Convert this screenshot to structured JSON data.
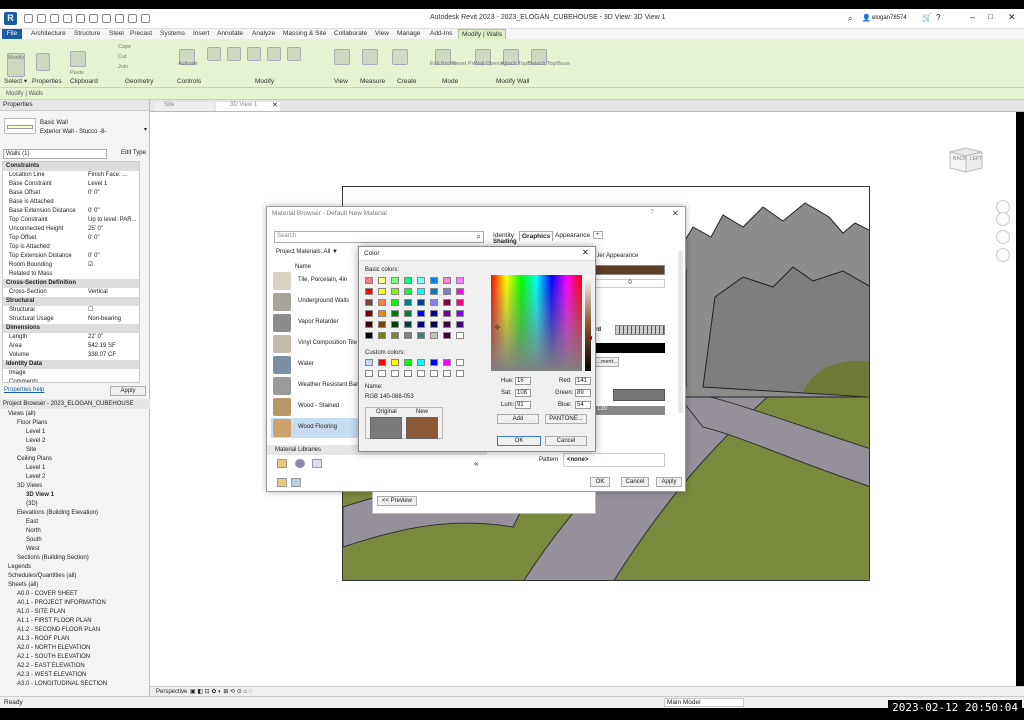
{
  "app": {
    "title": "Autodesk Revit 2023 - 2023_ELOGAN_CUBEHOUSE - 3D View: 3D View 1",
    "logo": "R",
    "user": "elogan78574"
  },
  "tabs": [
    "File",
    "Architecture",
    "Structure",
    "Steel",
    "Precast",
    "Systems",
    "Insert",
    "Annotate",
    "Analyze",
    "Massing & Site",
    "Collaborate",
    "View",
    "Manage",
    "Add-Ins",
    "Modify | Walls"
  ],
  "ribbon": {
    "groups": [
      "Select ▾",
      "Properties",
      "Clipboard",
      "Geometry",
      "Controls",
      "Modify",
      "View",
      "Measure",
      "Create",
      "Mode",
      "Modify Wall"
    ],
    "buttons": [
      "Modify",
      "Paste",
      "Cope",
      "Cut",
      "Join",
      "Activate",
      "Edit Profile",
      "Reset Profile",
      "Wall Opening",
      "Attach Top/Base",
      "Detach Top/Base"
    ]
  },
  "context_bar": "Modify | Walls",
  "properties": {
    "header": "Properties",
    "type_name": "Basic Wall",
    "type_sub": "Exterior Wall - Stucco -8-",
    "selector": "Walls (1)",
    "edit_type": "Edit Type",
    "sections": [
      {
        "name": "Constraints",
        "rows": [
          [
            "Location Line",
            "Finish Face: ..."
          ],
          [
            "Base Constraint",
            "Level 1"
          ],
          [
            "Base Offset",
            "0' 0\""
          ],
          [
            "Base is Attached",
            ""
          ],
          [
            "Base Extension Distance",
            "0' 0\""
          ],
          [
            "Top Constraint",
            "Up to level: PAR..."
          ],
          [
            "Unconnected Height",
            "25' 0\""
          ],
          [
            "Top Offset",
            "0' 0\""
          ],
          [
            "Top is Attached",
            ""
          ],
          [
            "Top Extension Distance",
            "0' 0\""
          ],
          [
            "Room Bounding",
            "☑"
          ],
          [
            "Related to Mass",
            ""
          ]
        ]
      },
      {
        "name": "Cross-Section Definition",
        "rows": [
          [
            "Cross-Section",
            "Vertical"
          ]
        ]
      },
      {
        "name": "Structural",
        "rows": [
          [
            "Structural",
            "☐"
          ],
          [
            "Structural Usage",
            "Non-bearing"
          ]
        ]
      },
      {
        "name": "Dimensions",
        "rows": [
          [
            "Length",
            "22' 0\""
          ],
          [
            "Area",
            "542.19 SF"
          ],
          [
            "Volume",
            "338.07 CF"
          ]
        ]
      },
      {
        "name": "Identity Data",
        "rows": [
          [
            "Image",
            ""
          ],
          [
            "Comments",
            ""
          ]
        ]
      }
    ],
    "help_link": "Properties help",
    "apply": "Apply"
  },
  "project_browser": {
    "header": "Project Browser - 2023_ELOGAN_CUBEHOUSE",
    "items": [
      {
        "label": "Views (all)",
        "indent": 0
      },
      {
        "label": "Floor Plans",
        "indent": 1
      },
      {
        "label": "Level 1",
        "indent": 2
      },
      {
        "label": "Level 2",
        "indent": 2
      },
      {
        "label": "Site",
        "indent": 2
      },
      {
        "label": "Ceiling Plans",
        "indent": 1
      },
      {
        "label": "Level 1",
        "indent": 2
      },
      {
        "label": "Level 2",
        "indent": 2
      },
      {
        "label": "3D Views",
        "indent": 1
      },
      {
        "label": "3D View 1",
        "indent": 2
      },
      {
        "label": "{3D}",
        "indent": 2
      },
      {
        "label": "Elevations (Building Elevation)",
        "indent": 1
      },
      {
        "label": "East",
        "indent": 2
      },
      {
        "label": "North",
        "indent": 2
      },
      {
        "label": "South",
        "indent": 2
      },
      {
        "label": "West",
        "indent": 2
      },
      {
        "label": "Sections (Building Section)",
        "indent": 1
      },
      {
        "label": "Legends",
        "indent": 0
      },
      {
        "label": "Schedules/Quantities (all)",
        "indent": 0
      },
      {
        "label": "Sheets (all)",
        "indent": 0
      },
      {
        "label": "A0.0 - COVER SHEET",
        "indent": 1
      },
      {
        "label": "A0.1 - PROJECT INFORMATION",
        "indent": 1
      },
      {
        "label": "A1.0 - SITE PLAN",
        "indent": 1
      },
      {
        "label": "A1.1 - FIRST FLOOR PLAN",
        "indent": 1
      },
      {
        "label": "A1.2 - SECOND FLOOR PLAN",
        "indent": 1
      },
      {
        "label": "A1.3 - ROOF PLAN",
        "indent": 1
      },
      {
        "label": "A2.0 - NORTH ELEVATION",
        "indent": 1
      },
      {
        "label": "A2.1 - SOUTH ELEVATION",
        "indent": 1
      },
      {
        "label": "A2.2 - EAST ELEVATION",
        "indent": 1
      },
      {
        "label": "A2.3 - WEST ELEVATION",
        "indent": 1
      },
      {
        "label": "A3.0 - LONGITUDINAL SECTION",
        "indent": 1
      }
    ]
  },
  "view_tabs": [
    "Site",
    "3D View 1"
  ],
  "viewcube": {
    "left": "BACK",
    "right": "LEFT"
  },
  "view_bottom": {
    "mode": "Perspective",
    "model": "Main Model"
  },
  "status": {
    "left": "Ready",
    "clock": "2023-02-12  20:50:04"
  },
  "material_browser": {
    "title": "Material Browser - Default New Material",
    "search_placeholder": "Search",
    "filter": "Project Materials: All ▼",
    "name_col": "Name",
    "materials": [
      {
        "name": "Tile, Porcelain, 4in",
        "color": "#d9d2c4"
      },
      {
        "name": "Underground Walls",
        "color": "#a8a39b"
      },
      {
        "name": "Vapor Retarder",
        "color": "#8c8c8c"
      },
      {
        "name": "Vinyl Composition Tile",
        "color": "#c2bba9"
      },
      {
        "name": "Water",
        "color": "#7a8fa3"
      },
      {
        "name": "Weather Resistant Barrier",
        "color": "#9a9a9a"
      },
      {
        "name": "Wood - Stained",
        "color": "#b89668"
      },
      {
        "name": "Wood Flooring",
        "color": "#c9a26e"
      }
    ],
    "libraries": "Material Libraries",
    "tabs": [
      "Identity",
      "Graphics",
      "Appearance",
      "+"
    ],
    "shading": "Shading",
    "appearance_label": "...ler Appearance",
    "transparency": "0",
    "pattern_label": "Pattern",
    "pattern_value": "<none>",
    "value_120": "120",
    "ok": "OK",
    "cancel": "Cancel",
    "apply": "Apply",
    "preview": "<< Preview",
    "rd_label": "rd",
    "alignment_btn": "...ment..."
  },
  "color_dialog": {
    "title": "Color",
    "basic_label": "Basic colors:",
    "custom_label": "Custom colors:",
    "name_label": "Name:",
    "name_value": "RGB 140-088-053",
    "original_label": "Original",
    "new_label": "New",
    "original_color": "#7a7a7a",
    "new_color": "#8c5835",
    "hue_label": "Hue:",
    "hue": "16",
    "sat_label": "Sat:",
    "sat": "108",
    "lum_label": "Lum:",
    "lum": "91",
    "red_label": "Red:",
    "red": "141",
    "green_label": "Green:",
    "green": "89",
    "blue_label": "Blue:",
    "blue": "54",
    "add": "Add",
    "pantone": "PANTONE...",
    "ok": "OK",
    "cancel": "Cancel",
    "basic_colors": [
      "#f08080",
      "#ffff80",
      "#80ff80",
      "#00ff80",
      "#80ffff",
      "#0080ff",
      "#ff80c0",
      "#ff80ff",
      "#ff0000",
      "#ffff00",
      "#80ff00",
      "#00ff40",
      "#00ffff",
      "#0080c0",
      "#8080c0",
      "#ff00ff",
      "#804040",
      "#ff8040",
      "#00ff00",
      "#008080",
      "#004080",
      "#8080ff",
      "#800040",
      "#ff0080",
      "#800000",
      "#ff8000",
      "#008000",
      "#008040",
      "#0000ff",
      "#0000a0",
      "#800080",
      "#8000ff",
      "#400000",
      "#804000",
      "#004000",
      "#004040",
      "#000080",
      "#000040",
      "#400040",
      "#400080",
      "#000000",
      "#808000",
      "#808040",
      "#808080",
      "#408080",
      "#c0c0c0",
      "#400040",
      "#ffffff"
    ],
    "custom_colors": [
      "#c0dcf0",
      "#ff0000",
      "#ffff00",
      "#00ff00",
      "#00ffff",
      "#0000ff",
      "#ff00ff",
      "#ffffff",
      "#ffffff",
      "#ffffff",
      "#ffffff",
      "#ffffff",
      "#ffffff",
      "#ffffff",
      "#ffffff",
      "#ffffff"
    ]
  }
}
